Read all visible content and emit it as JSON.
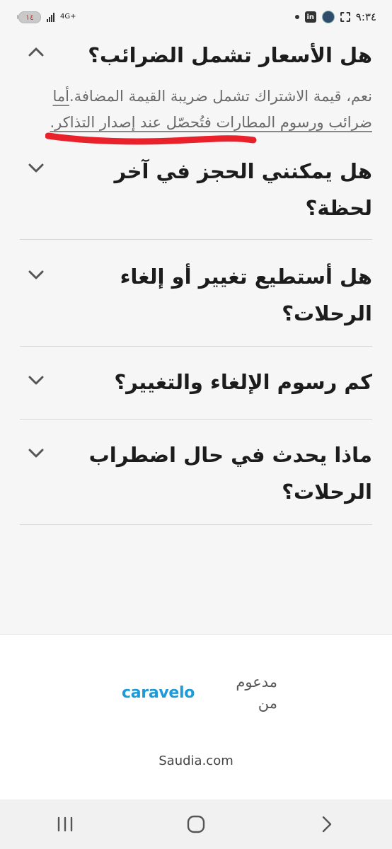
{
  "status_bar": {
    "battery": "١٤",
    "network": "4G+",
    "time": "٩:٣٤",
    "icons": [
      "battery-icon",
      "signal-icon",
      "dot-icon",
      "linkedin-icon",
      "saudia-app-icon",
      "screenshot-icon"
    ]
  },
  "faq": {
    "items": [
      {
        "question": "هل الأسعار تشمل الضرائب؟",
        "expanded": true,
        "answer_part1": "نعم، قيمة الاشتراك تشمل ضريبة القيمة المضافة.",
        "answer_part2": "أما ضرائب ورسوم المطارات فتُحصّل عند إصدار التذاكر."
      },
      {
        "question": "هل يمكنني الحجز في آخر لحظة؟",
        "expanded": false
      },
      {
        "question": "هل أستطيع تغيير أو إلغاء الرحلات؟",
        "expanded": false
      },
      {
        "question": "كم رسوم الإلغاء والتغيير؟",
        "expanded": false
      },
      {
        "question": "ماذا يحدث في حال اضطراب الرحلات؟",
        "expanded": false
      }
    ]
  },
  "sponsor": {
    "label": "مدعوم من",
    "brand": "caravelo",
    "brand_color": "#1e9ad6",
    "link": "Saudia.com"
  },
  "annotation": {
    "color": "#e8212b"
  },
  "nav": {
    "icons": [
      "recent-apps-icon",
      "home-icon",
      "back-icon"
    ]
  }
}
